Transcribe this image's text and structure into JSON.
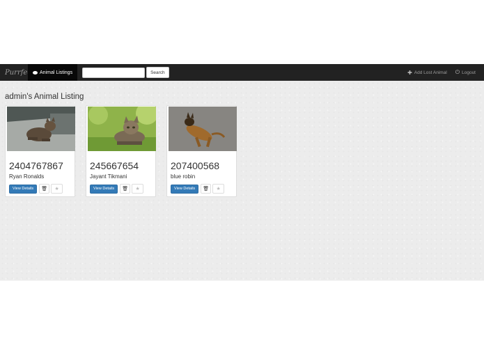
{
  "navbar": {
    "brand": "Purrfect",
    "active_tab": "Animal Listings",
    "search": {
      "value": "",
      "placeholder": ""
    },
    "search_button": "Search",
    "add_lost_label": "Add Lost Animal",
    "logout_label": "Logout"
  },
  "page": {
    "title": "admin's Animal Listing"
  },
  "icons": {
    "active_tab": "eye-icon",
    "add": "plus-icon",
    "logout": "power-icon",
    "delete": "trash-icon",
    "favorite": "star-icon"
  },
  "colors": {
    "navbar": "#222222",
    "primary_button": "#337ab7",
    "background": "#ececec"
  },
  "cards": [
    {
      "number": "2404767867",
      "owner": "Ryan Ronalds",
      "view_label": "View Details",
      "trash_glyph": "🗑",
      "star_glyph": "★"
    },
    {
      "number": "245667654",
      "owner": "Jayant Tikmani",
      "view_label": "View Details",
      "trash_glyph": "🗑",
      "star_glyph": "★"
    },
    {
      "number": "207400568",
      "owner": "blue robin",
      "view_label": "View Details",
      "trash_glyph": "🗑",
      "star_glyph": "★"
    }
  ]
}
